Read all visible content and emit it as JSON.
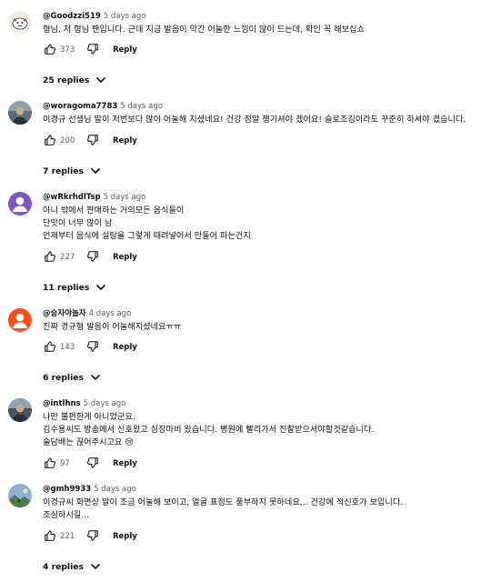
{
  "ui": {
    "reply_label": "Reply",
    "chevron_icon": "chevron-down-icon",
    "like_icon": "thumb-up-icon",
    "dislike_icon": "thumb-down-icon"
  },
  "comments": [
    {
      "author": "@Goodzzi519",
      "time": "5 days ago",
      "lines": [
        "형님, 저 형님 팬입니다. 근데 지금 발음이 약간 어눌한 느낌이 많이 드는데, 확인 꼭 해보십쇼"
      ],
      "likes": "373",
      "replies_label": "25 replies",
      "avatar": {
        "kind": "illustration",
        "bg": "#f3efe3"
      }
    },
    {
      "author": "@woragoma7783",
      "time": "5 days ago",
      "lines": [
        "이경규 선생님 말이  저번보다 많이 어눌해 지셨네요!   건강 정말 챙기셔야 겠어요!  슬로조깅이라도 꾸준히 하셔야 겠습니다."
      ],
      "likes": "200",
      "replies_label": "7 replies",
      "avatar": {
        "kind": "photo",
        "bg": "#5f6f78"
      }
    },
    {
      "author": "@wRkrhdlTsp",
      "time": "5 days ago",
      "lines": [
        "아니 밖에서 판매하는 거의모든 음식들이",
        "단맛이 너무 많이 남",
        "언제부터 음식에 설탕을 그렇게 때려넣어서 만들어 파는건지"
      ],
      "likes": "227",
      "replies_label": "11 replies",
      "avatar": {
        "kind": "default",
        "bg": "#7e57c2"
      }
    },
    {
      "author": "@승자야놀자",
      "time": "4 days ago",
      "lines": [
        "진짜 경규형 발음이 어눌해지셨네요ㅠㅠ"
      ],
      "likes": "143",
      "replies_label": "6 replies",
      "avatar": {
        "kind": "default",
        "bg": "#f4511e"
      }
    },
    {
      "author": "@intlhns",
      "time": "5 days ago",
      "lines": [
        "나만 불편한게 아니었군요.",
        "김수용씨도 방송에서 신호왔고 심장마비 왔습니다. 병원에 빨리가서 진찰받으셔야할것같습니다.",
        "술담배는 끊어주시고요 😢"
      ],
      "likes": "97",
      "replies_label": "",
      "avatar": {
        "kind": "photo",
        "bg": "#48525e"
      }
    },
    {
      "author": "@gmh9933",
      "time": "5 days ago",
      "lines": [
        "이경규씨 화면상 말이 조금 어눌해 보이고, 얼굴 표정도 풍부하지 못하네요... 건강에 적신호가 보입니다.",
        "조심하시길..."
      ],
      "likes": "221",
      "replies_label": "4 replies",
      "avatar": {
        "kind": "landscape",
        "bg": "#8fb0d0"
      }
    }
  ]
}
